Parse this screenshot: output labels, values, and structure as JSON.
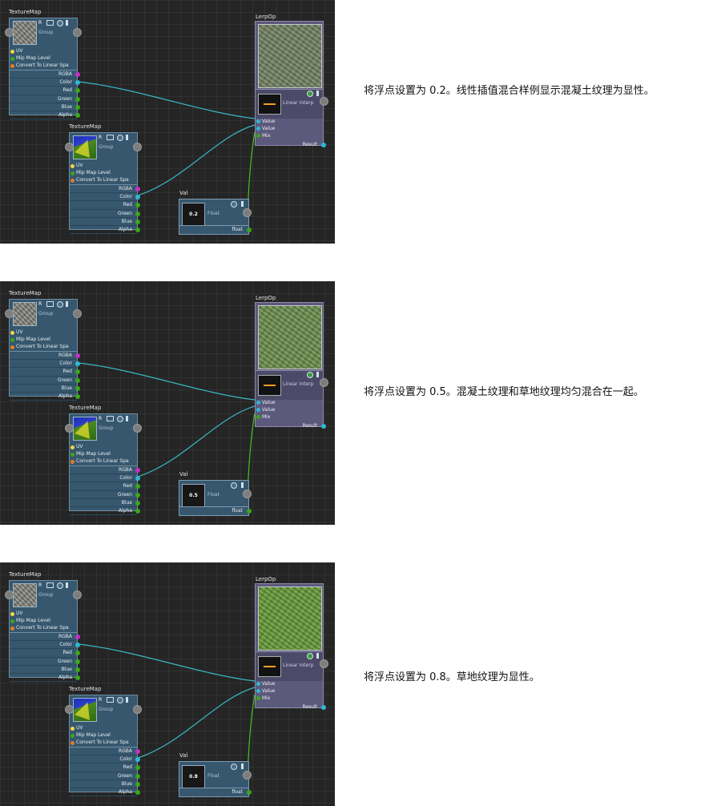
{
  "labels": {
    "texture_map": "TextureMap",
    "lerp_op": "LerpOp",
    "val": "Val",
    "group": "Group",
    "r": "R",
    "inputs": [
      "UV",
      "Mip Map Level",
      "Convert To Linear Spa"
    ],
    "outputs": [
      "RGBA",
      "Color",
      "Red",
      "Green",
      "Blue",
      "Alpha"
    ],
    "lerp_inner": "Linear Interp",
    "lerp_inputs": [
      "Value",
      "Value",
      "Mix"
    ],
    "result": "Result",
    "float": "Float",
    "float_out": "float"
  },
  "colors": {
    "uv_dot": "#f6d34a",
    "mip_dot": "#3aa71a",
    "convert_dot": "#e07c2c",
    "rgba_dot": "#c431c4",
    "color_dot": "#30b8d4",
    "channel_dot": "#3aa71a",
    "wire_color": "#38b7c3",
    "wire_float": "#45c21e"
  },
  "panels": [
    {
      "value": "0.2",
      "mix": 0.2,
      "caption": "将浮点设置为 0.2。线性插值混合样例显示混凝土纹理为显性。"
    },
    {
      "value": "0.5",
      "mix": 0.5,
      "caption": "将浮点设置为 0.5。混凝土纹理和草地纹理均匀混合在一起。"
    },
    {
      "value": "0.8",
      "mix": 0.8,
      "caption": "将浮点设置为 0.8。草地纹理为显性。"
    }
  ]
}
